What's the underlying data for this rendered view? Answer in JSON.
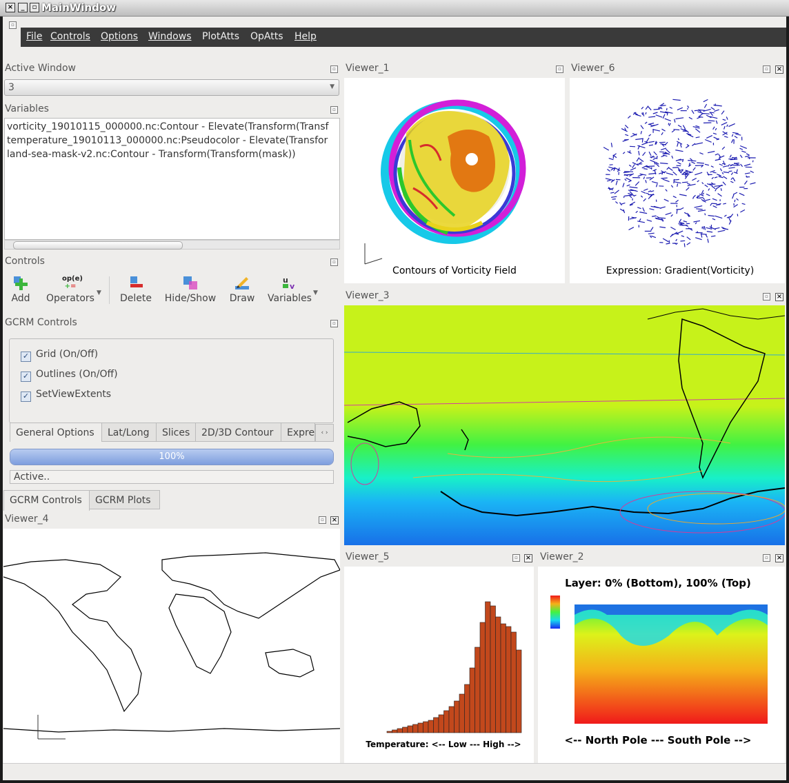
{
  "window": {
    "title": "MainWindow"
  },
  "menu": [
    "File",
    "Controls",
    "Options",
    "Windows",
    "PlotAtts",
    "OpAtts",
    "Help"
  ],
  "active_window": {
    "label": "Active Window",
    "value": "3"
  },
  "variables": {
    "label": "Variables",
    "items": [
      "vorticity_19010115_000000.nc:Contour - Elevate(Transform(Transf",
      "temperature_19010113_000000.nc:Pseudocolor - Elevate(Transfor",
      "land-sea-mask-v2.nc:Contour - Transform(Transform(mask))"
    ]
  },
  "controls": {
    "label": "Controls",
    "tools": [
      "Add",
      "Operators",
      "Delete",
      "Hide/Show",
      "Draw",
      "Variables"
    ],
    "operators_icon_text": "op(e)"
  },
  "gcrm": {
    "label": "GCRM Controls",
    "checkboxes": [
      "Grid (On/Off)",
      "Outlines (On/Off)",
      "SetViewExtents"
    ],
    "tabs": [
      "General Options",
      "Lat/Long",
      "Slices",
      "2D/3D Contour",
      "Expre"
    ],
    "progress_percent": 100,
    "progress_text": "100%",
    "status": "Active..",
    "bottom_tabs": [
      "GCRM Controls",
      "GCRM Plots"
    ]
  },
  "viewers": {
    "v1": {
      "title": "Viewer_1",
      "caption": "Contours of Vorticity Field"
    },
    "v6": {
      "title": "Viewer_6",
      "caption": "Expression: Gradient(Vorticity)"
    },
    "v3": {
      "title": "Viewer_3"
    },
    "v4": {
      "title": "Viewer_4"
    },
    "v5": {
      "title": "Viewer_5",
      "caption": "Temperature: <-- Low --- High -->"
    },
    "v2": {
      "title": "Viewer_2",
      "caption": "Layer: 0% (Bottom), 100% (Top)",
      "footer": "<-- North Pole --- South Pole -->"
    }
  },
  "histogram": {
    "values": [
      0.01,
      0.02,
      0.03,
      0.04,
      0.05,
      0.06,
      0.07,
      0.08,
      0.09,
      0.11,
      0.13,
      0.16,
      0.19,
      0.23,
      0.28,
      0.35,
      0.47,
      0.62,
      0.8,
      0.95,
      0.92,
      0.84,
      0.79,
      0.77,
      0.73,
      0.6
    ]
  },
  "colors": {
    "bar": "#c2481c",
    "menubar": "#3a3a3a",
    "progress": "#8aa8e0"
  }
}
